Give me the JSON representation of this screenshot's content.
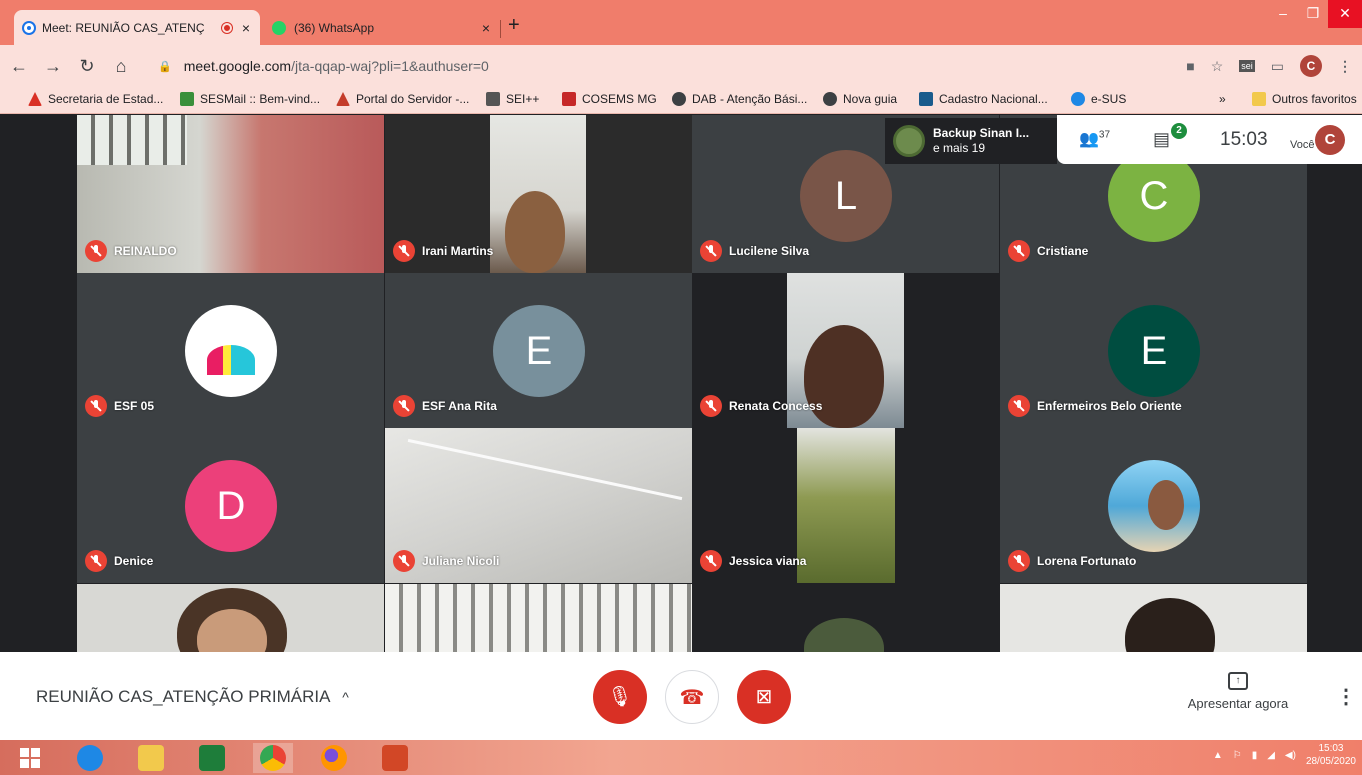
{
  "browser": {
    "tabs": [
      {
        "title": "Meet: REUNIÃO CAS_ATENÇ",
        "active": true
      },
      {
        "title": "(36) WhatsApp",
        "active": false
      }
    ],
    "new_tab": "+",
    "tab_close": "×",
    "window_controls": {
      "minimize": "–",
      "restore": "❐",
      "close": "✕"
    },
    "url_host": "meet.google.com",
    "url_path": "/jta-qqap-waj?pli=1&authuser=0",
    "profile_initial": "C",
    "bookmarks": [
      {
        "label": "Secretaria de Estad...",
        "color": "#d93025"
      },
      {
        "label": "SESMail :: Bem-vind...",
        "color": "#3a8f3a"
      },
      {
        "label": "Portal do Servidor -...",
        "color": "#c43c2a"
      },
      {
        "label": "SEI++",
        "color": "#555555"
      },
      {
        "label": "COSEMS MG",
        "color": "#c62828"
      },
      {
        "label": "DAB - Atenção Bási...",
        "color": "#3c4043"
      },
      {
        "label": "Nova guia",
        "color": "#3c4043"
      },
      {
        "label": "Cadastro Nacional...",
        "color": "#1a5b8c"
      },
      {
        "label": "e-SUS",
        "color": "#1e88e5"
      }
    ],
    "bookmarks_more": "»",
    "other_bookmarks": "Outros favoritos"
  },
  "meet": {
    "recording": {
      "line1": "Backup Sinan I...",
      "line2": "e mais 19"
    },
    "people_count": "37",
    "chat_badge": "2",
    "clock": "15:03",
    "you_label": "Você",
    "self_initial": "C",
    "meeting_name": "REUNIÃO CAS_ATENÇÃO PRIMÁRIA",
    "meeting_chevron": "^",
    "present_label": "Apresentar agora",
    "participants": [
      {
        "name": "REINALDO"
      },
      {
        "name": "Irani Martins"
      },
      {
        "name": "Lucilene Silva",
        "initial": "L",
        "color": "#795548"
      },
      {
        "name": "Cristiane",
        "initial": "C",
        "color": "#7cb342"
      },
      {
        "name": "ESF 05"
      },
      {
        "name": "ESF Ana Rita",
        "initial": "E",
        "color": "#78909c"
      },
      {
        "name": "Renata Concess"
      },
      {
        "name": "Enfermeiros Belo Oriente",
        "initial": "E",
        "color": "#004d40"
      },
      {
        "name": "Denice",
        "initial": "D",
        "color": "#ec407a"
      },
      {
        "name": "Juliane Nicoli"
      },
      {
        "name": "Jessica viana"
      },
      {
        "name": "Lorena Fortunato"
      }
    ]
  },
  "taskbar": {
    "time": "15:03",
    "date": "28/05/2020"
  }
}
